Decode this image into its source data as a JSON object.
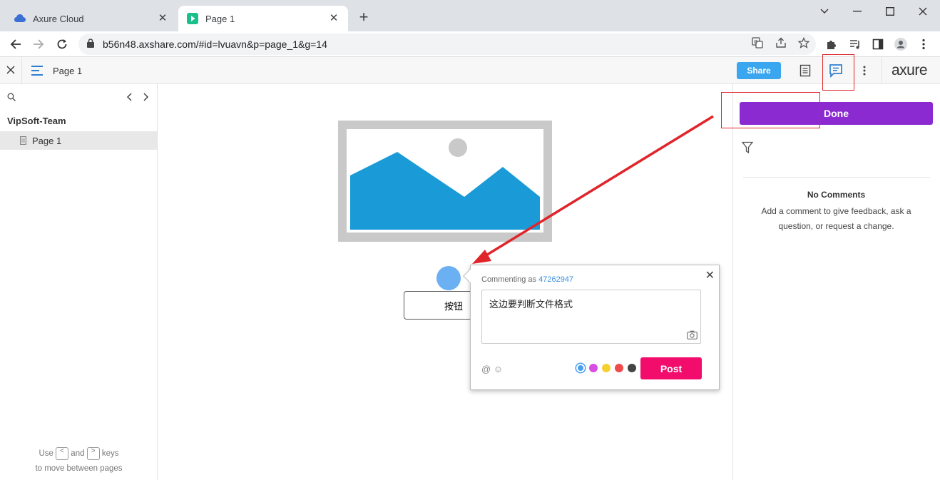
{
  "browser": {
    "tabs": [
      {
        "title": "Axure Cloud",
        "active": false
      },
      {
        "title": "Page 1",
        "active": true
      }
    ],
    "url": "b56n48.axshare.com/#id=lvuavn&p=page_1&g=14"
  },
  "axure_header": {
    "page_title": "Page 1",
    "share_label": "Share",
    "brand": "axure"
  },
  "sidebar": {
    "project_name": "VipSoft-Team",
    "pages": [
      {
        "label": "Page 1"
      }
    ],
    "hint_use": "Use",
    "hint_and": "and",
    "hint_keys": "keys",
    "hint_line2": "to move between pages",
    "key_prev": "<",
    "key_next": ">"
  },
  "canvas": {
    "button_label": "按钮"
  },
  "comment_popup": {
    "commenting_as": "Commenting as",
    "user_id": "47262947",
    "text": "这边要判断文件格式",
    "tools": "@ ☺",
    "post_label": "Post",
    "colors": [
      "#4a9ff0",
      "#d64fe0",
      "#f5d130",
      "#f04a4a",
      "#444444"
    ]
  },
  "right_panel": {
    "done_label": "Done",
    "no_comments_title": "No Comments",
    "no_comments_desc": "Add a comment to give feedback, ask a question, or request a change."
  },
  "colors": {
    "accent_blue": "#3aa6f0",
    "done_purple": "#8b2ad0",
    "post_pink": "#f20d6d",
    "annotation_red": "#e0242a"
  }
}
